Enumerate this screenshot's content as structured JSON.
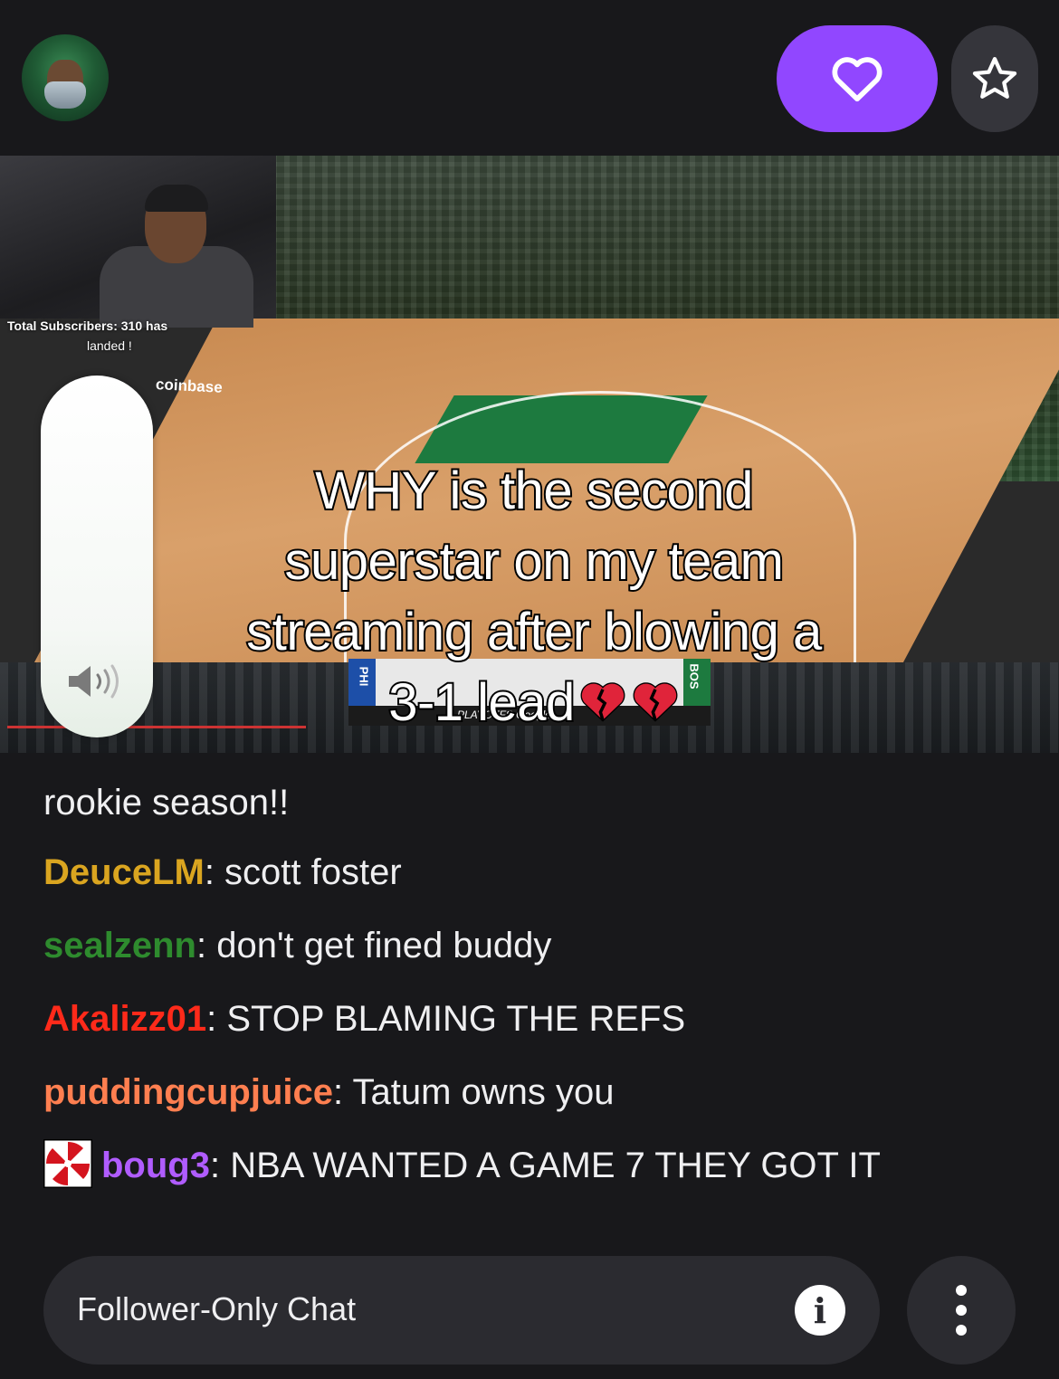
{
  "header": {
    "follow_icon": "heart-icon",
    "favorite_icon": "star-icon"
  },
  "video": {
    "webcam_overlay": {
      "subs_text": "Total Subscribers: 310",
      "has_text": "has",
      "landed_text": "landed !"
    },
    "sponsor_text": "coinbase",
    "caption_lines": [
      "WHY is the second",
      "superstar on my team",
      "streaming after blowing a",
      "3-1 lead"
    ],
    "caption_emoji": "broken-heart-icon",
    "scorebar": {
      "left_team": "PHI",
      "right_team": "BOS",
      "bottom_text": "PLAYOFFS  Google"
    },
    "volume_icon": "speaker-icon"
  },
  "chat": {
    "messages": [
      {
        "user": "",
        "text": "rookie season!!",
        "color": "#efeff1"
      },
      {
        "user": "DeuceLM",
        "text": "scott foster",
        "color": "#daa520"
      },
      {
        "user": "sealzenn",
        "text": "don't get fined buddy",
        "color": "#2e8b57"
      },
      {
        "user": "Akalizz01",
        "text": "STOP BLAMING THE REFS",
        "color": "#ff2a1a"
      },
      {
        "user": "puddingcupjuice",
        "text": "Tatum owns you",
        "color": "#ff7f50"
      },
      {
        "user": "boug3",
        "text": "NBA WANTED A GAME 7 THEY GOT IT",
        "color": "#b05cff",
        "badge": "umbrella-badge-icon"
      }
    ],
    "separator": ": "
  },
  "input": {
    "placeholder": "Follower-Only Chat",
    "info_label": "i",
    "more_icon": "more-vertical-icon"
  },
  "colors": {
    "accent": "#9147ff",
    "background": "#18181b",
    "input_bg": "#2b2b30"
  }
}
